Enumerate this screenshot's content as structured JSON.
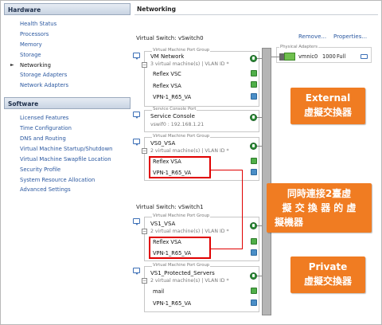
{
  "hardware": {
    "title": "Hardware",
    "items": [
      {
        "label": "Health Status"
      },
      {
        "label": "Processors"
      },
      {
        "label": "Memory"
      },
      {
        "label": "Storage"
      },
      {
        "label": "Networking",
        "active": true
      },
      {
        "label": "Storage Adapters"
      },
      {
        "label": "Network Adapters"
      }
    ]
  },
  "software": {
    "title": "Software",
    "items": [
      {
        "label": "Licensed Features"
      },
      {
        "label": "Time Configuration"
      },
      {
        "label": "DNS and Routing"
      },
      {
        "label": "Virtual Machine Startup/Shutdown"
      },
      {
        "label": "Virtual Machine Swapfile Location"
      },
      {
        "label": "Security Profile"
      },
      {
        "label": "System Resource Allocation"
      },
      {
        "label": "Advanced Settings"
      }
    ]
  },
  "networking": {
    "title": "Networking",
    "remove_link": "Remove...",
    "properties_link": "Properties...",
    "switch0": {
      "label": "Virtual Switch: vSwitch0",
      "physical_adapters_label": "Physical Adapters",
      "nic_name": "vmnic0",
      "nic_speed": "1000",
      "nic_duplex": "Full",
      "groups": [
        {
          "legend": "Virtual Machine Port Group",
          "name": "VM Network",
          "meta": "3 virtual machine(s) | VLAN ID *",
          "vms": [
            "Reflex VSC",
            "Reflex VSA",
            "VPN-1_R65_VA"
          ]
        },
        {
          "legend": "Service Console Port",
          "name": "Service Console",
          "meta": "vswif0 : 192.168.1.21",
          "vms": []
        },
        {
          "legend": "Virtual Machine Port Group",
          "name": "VS0_VSA",
          "meta": "2 virtual machine(s) | VLAN ID *",
          "vms": [
            "Reflex VSA",
            "VPN-1_R65_VA"
          ]
        }
      ]
    },
    "switch1": {
      "label": "Virtual Switch: vSwitch1",
      "groups": [
        {
          "legend": "Virtual Machine Port Group",
          "name": "VS1_VSA",
          "meta": "2 virtual machine(s) | VLAN ID *",
          "vms": [
            "Reflex VSA",
            "VPN-1_R65_VA"
          ]
        },
        {
          "legend": "Virtual Machine Port Group",
          "name": "VS1_Protected_Servers",
          "meta": "2 virtual machine(s) | VLAN ID *",
          "vms": [
            "mail",
            "VPN-1_R65_VA"
          ]
        }
      ]
    }
  },
  "callouts": {
    "external": {
      "line1": "External",
      "line2": "虛擬交換器"
    },
    "middle": {
      "line1": "同時連接2臺虛",
      "line2": "擬 交 換 器 的 虛",
      "line3": "擬機器"
    },
    "private": {
      "line1": "Private",
      "line2": "虛擬交換器"
    }
  },
  "colors": {
    "callout": "#f07c22",
    "highlight": "#e00000",
    "link": "#2b58a0"
  }
}
